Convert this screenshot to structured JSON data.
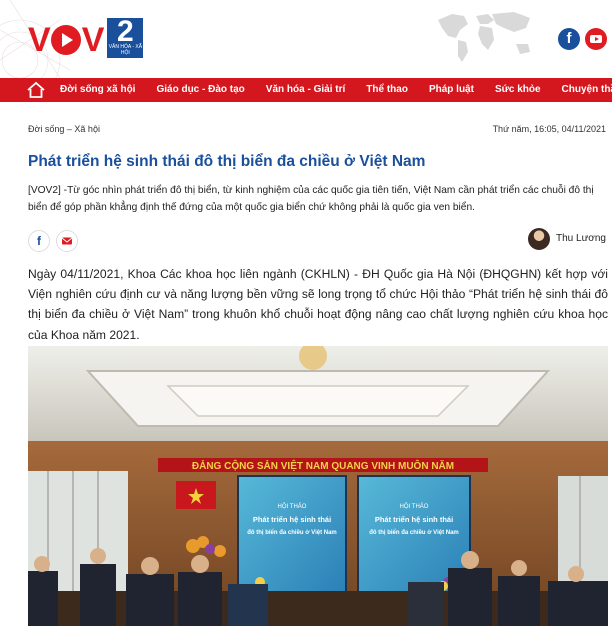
{
  "header": {
    "logo_text": "VOV",
    "logo_channel": "2",
    "logo_sub": "VĂN HÓA - XÃ HỘI",
    "social": [
      {
        "name": "facebook",
        "glyph": "f",
        "color": "#1a4f9c"
      },
      {
        "name": "youtube",
        "icon": "youtube-icon",
        "color": "#e01b22"
      }
    ]
  },
  "nav": {
    "home_icon": "home-icon",
    "items": [
      "Đời sống xã hội",
      "Giáo dục - Đào tạo",
      "Văn hóa - Giải trí",
      "Thể thao",
      "Pháp luật",
      "Sức khỏe",
      "Chuyện thầm kín"
    ]
  },
  "article": {
    "breadcrumb": "Đời sống – Xã hội",
    "datetime": "Thứ năm, 16:05, 04/11/2021",
    "title": "Phát triển hệ sinh thái đô thị biển đa chiều ở Việt Nam",
    "lead": "[VOV2] -Từ góc nhìn phát triển đô thị biển, từ kinh nghiệm của các quốc gia tiên tiến, Việt Nam cần phát triển các chuỗi đô thị biển để góp phần khẳng định thế đứng của một quốc gia biển chứ không phải là quốc gia ven biển.",
    "share": {
      "facebook_glyph": "f",
      "mail_icon": "mail-icon"
    },
    "author": "Thu Lương",
    "body": "Ngày 04/11/2021, Khoa Các khoa học liên ngành (CKHLN) - ĐH Quốc gia Hà Nội (ĐHQGHN) kết hợp với Viện nghiên cứu định cư và năng lượng bền vững sẽ long trọng tổ chức Hội thảo “Phát triển hệ sinh thái đô thị biển đa chiều ở Việt Nam” trong khuôn khổ chuỗi hoạt động nâng cao chất lượng nghiên cứu khoa học của Khoa năm 2021."
  },
  "photo": {
    "banner": "ĐẢNG CỘNG SẢN VIỆT NAM QUANG VINH MUÔN NĂM",
    "screen_heading": "HỘI THẢO",
    "screen_line1": "Phát triển hệ sinh thái",
    "screen_line2": "đô thị biển đa chiều ở Việt Nam"
  },
  "colors": {
    "brand_red": "#d4171e",
    "brand_blue": "#1a4f9c",
    "title_blue": "#1a4f9c"
  }
}
